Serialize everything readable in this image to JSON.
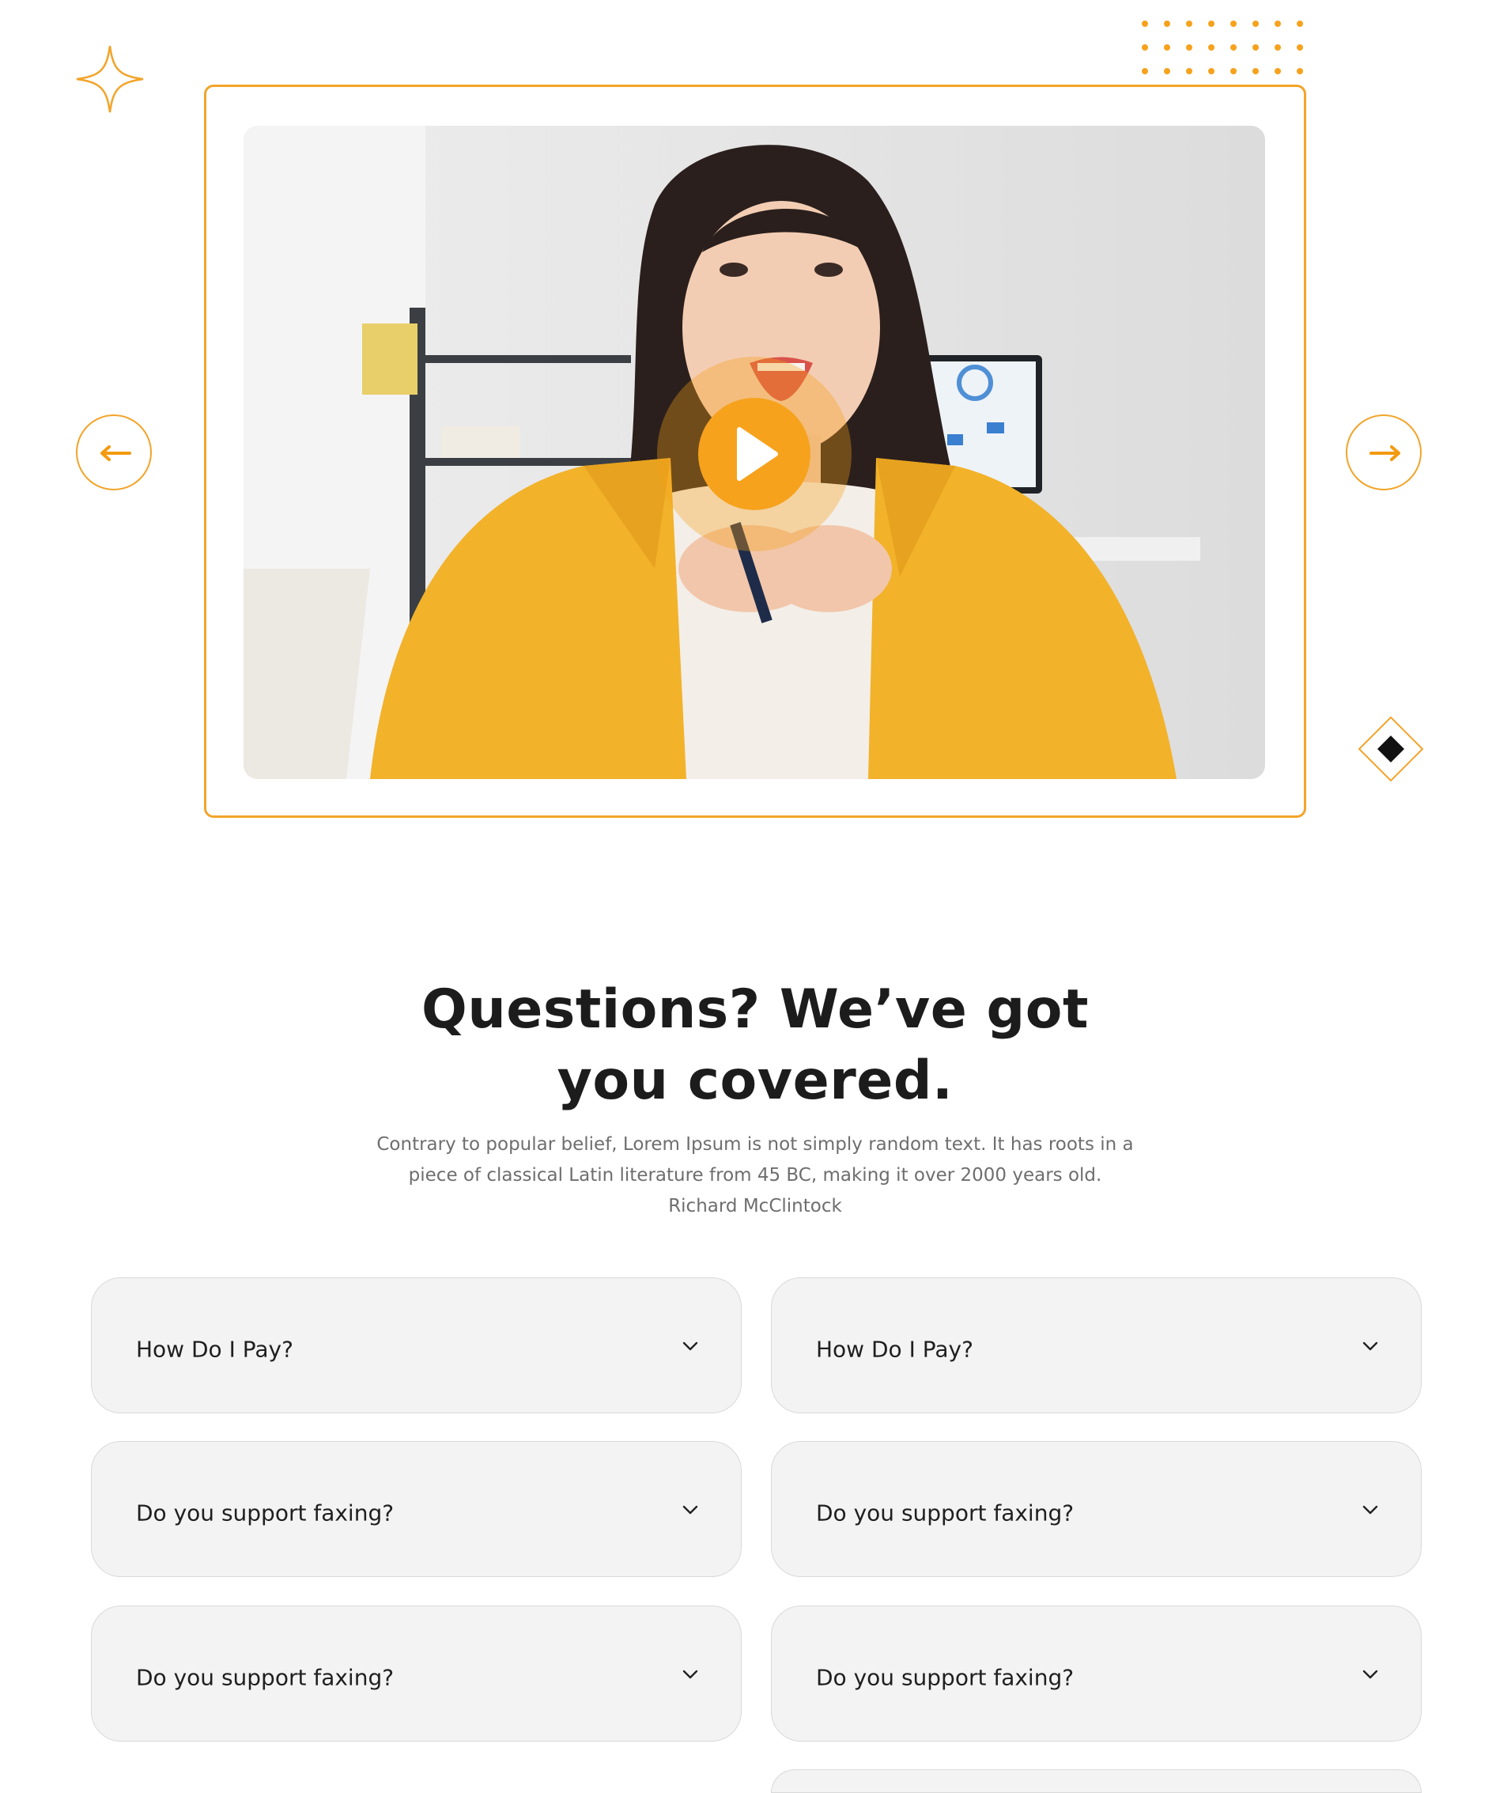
{
  "colors": {
    "accent": "#f2a42a",
    "play": "#f6a21d",
    "card_bg": "#f3f3f3",
    "heading": "#1c1c1c",
    "body_text": "#6e6e6e"
  },
  "video": {
    "thumbnail_icon": "video-thumbnail-image",
    "play_icon": "play-icon"
  },
  "carousel": {
    "prev_icon": "arrow-left-icon",
    "next_icon": "arrow-right-icon"
  },
  "faq": {
    "title": "Questions? We’ve got you covered.",
    "description": "Contrary to popular belief, Lorem Ipsum is not simply random text. It has roots in a piece of classical Latin literature from 45 BC, making it over 2000 years old. Richard McClintock",
    "items": [
      {
        "question": "How Do I Pay?"
      },
      {
        "question": "How Do I Pay?"
      },
      {
        "question": "Do you support faxing?"
      },
      {
        "question": "Do you support faxing?"
      },
      {
        "question": "Do you support faxing?"
      },
      {
        "question": "Do you support faxing?"
      }
    ]
  }
}
